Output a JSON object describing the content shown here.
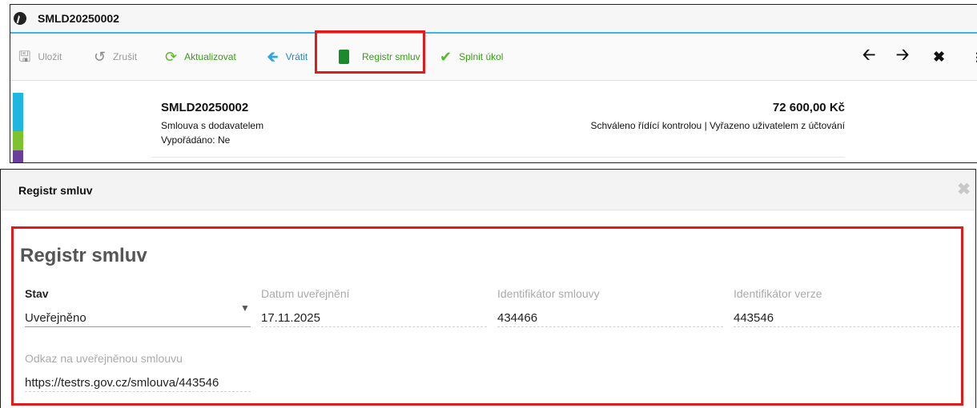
{
  "window": {
    "title": "SMLD20250002"
  },
  "toolbar": {
    "save": "Uložit",
    "cancel": "Zrušit",
    "refresh": "Aktualizovat",
    "back": "Vrátit",
    "registry": "Registr smluv",
    "complete": "Splnit úkol"
  },
  "record": {
    "id": "SMLD20250002",
    "type": "Smlouva s dodavatelem",
    "settled": "Vypořádáno: Ne",
    "amount": "72 600,00 Kč",
    "status": "Schváleno řídící kontrolou | Vyřazeno uživatelem z účtování"
  },
  "colors": {
    "accent": "#38b6db",
    "highlight": "#e01b1b",
    "strip": [
      "#1fb6e0",
      "#1fb6e0",
      "#7dc22f",
      "#6a3f9a"
    ]
  },
  "dialog": {
    "title": "Registr smluv",
    "form_title": "Registr smluv",
    "fields": {
      "stav": {
        "label": "Stav",
        "value": "Uveřejněno"
      },
      "datum": {
        "label": "Datum uveřejnění",
        "value": "17.11.2025"
      },
      "id_smlouvy": {
        "label": "Identifikátor smlouvy",
        "value": "434466"
      },
      "id_verze": {
        "label": "Identifikátor verze",
        "value": "443546"
      },
      "odkaz": {
        "label": "Odkaz na uveřejněnou smlouvu",
        "value": "https://testrs.gov.cz/smlouva/443546"
      }
    }
  }
}
